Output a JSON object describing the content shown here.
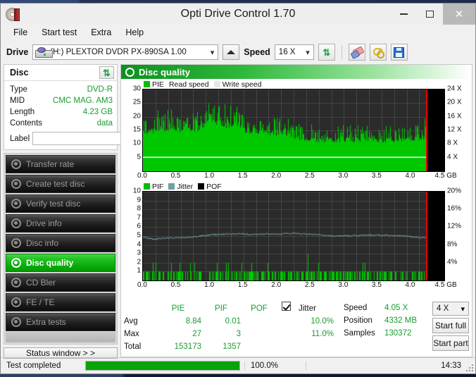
{
  "window": {
    "title": "Opti Drive Control 1.70",
    "app_icon": "disc-icon",
    "minimize": "–",
    "maximize": "□",
    "close": "✕"
  },
  "menu": {
    "items": [
      "File",
      "Start test",
      "Extra",
      "Help"
    ]
  },
  "toolbar": {
    "drive_label": "Drive",
    "drive_value": "(H:)  PLEXTOR DVDR  PX-890SA 1.00",
    "eject_title": "Eject",
    "speed_label": "Speed",
    "speed_value": "16 X",
    "refresh_icon": "refresh-icon",
    "erase_icon": "eraser-icon",
    "keys_icon": "keys-icon",
    "save_icon": "save-icon"
  },
  "disc_panel": {
    "header": "Disc",
    "refresh_icon": "refresh-icon",
    "rows": [
      {
        "key": "Type",
        "value": "DVD-R"
      },
      {
        "key": "MID",
        "value": "CMC MAG. AM3"
      },
      {
        "key": "Length",
        "value": "4.23 GB"
      },
      {
        "key": "Contents",
        "value": "data"
      }
    ],
    "label_key": "Label",
    "label_value": "",
    "label_placeholder": "",
    "disc_button_icon": "cd-icon"
  },
  "nav": {
    "items": [
      {
        "label": "Transfer rate",
        "icon": "gauge-icon",
        "active": false
      },
      {
        "label": "Create test disc",
        "icon": "gauge-icon",
        "active": false
      },
      {
        "label": "Verify test disc",
        "icon": "gauge-icon",
        "active": false
      },
      {
        "label": "Drive info",
        "icon": "gauge-icon",
        "active": false
      },
      {
        "label": "Disc info",
        "icon": "gauge-icon",
        "active": false
      },
      {
        "label": "Disc quality",
        "icon": "gauge-icon",
        "active": true
      },
      {
        "label": "CD Bler",
        "icon": "gauge-icon",
        "active": false
      },
      {
        "label": "FE / TE",
        "icon": "gauge-icon",
        "active": false
      },
      {
        "label": "Extra tests",
        "icon": "gauge-icon",
        "active": false
      }
    ],
    "status_window_button": "Status window > >"
  },
  "panel": {
    "title": "Disc quality",
    "icon": "gauge-icon"
  },
  "stats": {
    "col_headers": [
      "",
      "PIE",
      "PIF",
      "POF",
      "",
      "Jitter"
    ],
    "jitter_checked": true,
    "jitter_label": "Jitter",
    "rows": [
      {
        "label": "Avg",
        "pie": "8.84",
        "pif": "0.01",
        "pof": "",
        "jitter": "10.0%"
      },
      {
        "label": "Max",
        "pie": "27",
        "pif": "3",
        "pof": "",
        "jitter": "11.0%"
      },
      {
        "label": "Total",
        "pie": "153173",
        "pif": "1357",
        "pof": "",
        "jitter": ""
      }
    ],
    "right": [
      {
        "key": "Speed",
        "value": "4.05 X"
      },
      {
        "key": "Position",
        "value": "4332 MB"
      },
      {
        "key": "Samples",
        "value": "130372"
      }
    ],
    "speed_select": "4 X",
    "start_full": "Start full",
    "start_part": "Start part"
  },
  "statusbar": {
    "message": "Test completed",
    "progress_percent": 100.0,
    "progress_text": "100.0%",
    "time": "14:33"
  },
  "colors": {
    "accent_green": "#09a309",
    "value_green": "#179c2e",
    "jitter_line": "#6f9fa8",
    "marker_red": "#e60000",
    "plot_bg": "#2b2b2b"
  },
  "chart_data": [
    {
      "id": "pie-chart",
      "type": "bar",
      "title": "PIE",
      "legend": [
        {
          "label": "PIE",
          "color": "#00c000",
          "swatch": true
        },
        {
          "label": "Read speed",
          "color": "#ffffff",
          "swatch": false
        },
        {
          "label": "Write speed",
          "color": "#e6e6e6",
          "swatch": true
        }
      ],
      "xlabel": "GB",
      "xlim": [
        0,
        4.5
      ],
      "xticks": [
        0.0,
        0.5,
        1.0,
        1.5,
        2.0,
        2.5,
        3.0,
        3.5,
        4.0,
        4.5
      ],
      "xticklabels": [
        "0.0",
        "0.5",
        "1.0",
        "1.5",
        "2.0",
        "2.5",
        "3.0",
        "3.5",
        "4.0",
        "4.5"
      ],
      "ylim": [
        0,
        30
      ],
      "yticks": [
        5,
        10,
        15,
        20,
        25,
        30
      ],
      "yticklabels": [
        "5",
        "10",
        "15",
        "20",
        "25",
        "30"
      ],
      "y2lim": [
        0,
        24
      ],
      "y2ticks": [
        4,
        8,
        12,
        16,
        20,
        24
      ],
      "y2ticklabels": [
        "4 X",
        "8 X",
        "12 X",
        "16 X",
        "20 X",
        "24 X"
      ],
      "data_end_x": 4.23,
      "marker_x": 4.23,
      "read_speed_value": 4.05,
      "read_speed_plot_y": 5.1,
      "envelope": {
        "x": [
          0.0,
          0.2,
          0.4,
          0.6,
          0.8,
          1.0,
          1.1,
          1.25,
          1.4,
          1.6,
          1.8,
          2.0,
          2.2,
          2.4,
          2.6,
          2.8,
          3.0,
          3.2,
          3.4,
          3.6,
          3.8,
          4.0,
          4.23
        ],
        "mean": [
          15.5,
          16.5,
          16.8,
          16.5,
          17.0,
          19.5,
          20.5,
          18.5,
          18.0,
          16.0,
          15.5,
          15.5,
          14.5,
          13.0,
          12.5,
          12.5,
          12.5,
          12.5,
          12.5,
          12.5,
          12.5,
          13.0,
          13.5
        ],
        "peak": [
          21.0,
          22.5,
          24.0,
          21.5,
          23.0,
          26.0,
          27.0,
          24.5,
          24.0,
          21.0,
          20.0,
          20.0,
          19.5,
          18.0,
          17.0,
          17.0,
          17.0,
          17.5,
          17.0,
          17.0,
          17.5,
          19.0,
          19.5
        ],
        "low": [
          13.5,
          14.0,
          14.5,
          14.0,
          14.5,
          16.0,
          17.0,
          15.5,
          15.0,
          13.5,
          13.0,
          13.0,
          12.0,
          11.0,
          10.5,
          10.5,
          10.5,
          10.5,
          10.5,
          10.5,
          10.5,
          11.0,
          11.5
        ]
      },
      "avg": 8.84,
      "max": 27,
      "total": 153173
    },
    {
      "id": "pif-chart",
      "type": "bar",
      "title": "PIF",
      "legend": [
        {
          "label": "PIF",
          "color": "#00c000",
          "swatch": true
        },
        {
          "label": "Jitter",
          "color": "#6f9fa8",
          "swatch": true
        },
        {
          "label": "POF",
          "color": "#000000",
          "swatch": true
        }
      ],
      "xlabel": "GB",
      "xlim": [
        0,
        4.5
      ],
      "xticks": [
        0.0,
        0.5,
        1.0,
        1.5,
        2.0,
        2.5,
        3.0,
        3.5,
        4.0,
        4.5
      ],
      "xticklabels": [
        "0.0",
        "0.5",
        "1.0",
        "1.5",
        "2.0",
        "2.5",
        "3.0",
        "3.5",
        "4.0",
        "4.5"
      ],
      "ylim": [
        0,
        10
      ],
      "yticks": [
        1,
        2,
        3,
        4,
        5,
        6,
        7,
        8,
        9,
        10
      ],
      "yticklabels": [
        "1",
        "2",
        "3",
        "4",
        "5",
        "6",
        "7",
        "8",
        "9",
        "10"
      ],
      "y2lim": [
        0,
        20
      ],
      "y2ticks": [
        4,
        8,
        12,
        16,
        20
      ],
      "y2ticklabels": [
        "4%",
        "8%",
        "12%",
        "16%",
        "20%"
      ],
      "data_end_x": 4.23,
      "marker_x": 4.23,
      "jitter_series": {
        "x": [
          0.0,
          0.15,
          0.3,
          0.45,
          0.6,
          0.75,
          0.9,
          1.05,
          1.2,
          1.35,
          1.5,
          1.65,
          1.8,
          1.95,
          2.1,
          2.25,
          2.4,
          2.55,
          2.7,
          2.85,
          3.0,
          3.15,
          3.3,
          3.45,
          3.6,
          3.75,
          3.9,
          4.05,
          4.23
        ],
        "y_pct": [
          9.8,
          9.3,
          9.5,
          9.6,
          9.6,
          9.8,
          10.1,
          10.3,
          10.4,
          10.5,
          10.5,
          10.4,
          10.5,
          10.4,
          10.5,
          10.6,
          10.5,
          10.4,
          10.2,
          10.0,
          10.1,
          10.1,
          10.2,
          10.2,
          10.2,
          10.1,
          10.0,
          9.8,
          9.6
        ]
      },
      "pif_max": 3,
      "avg": 0.01,
      "max": 3,
      "total": 1357
    }
  ]
}
